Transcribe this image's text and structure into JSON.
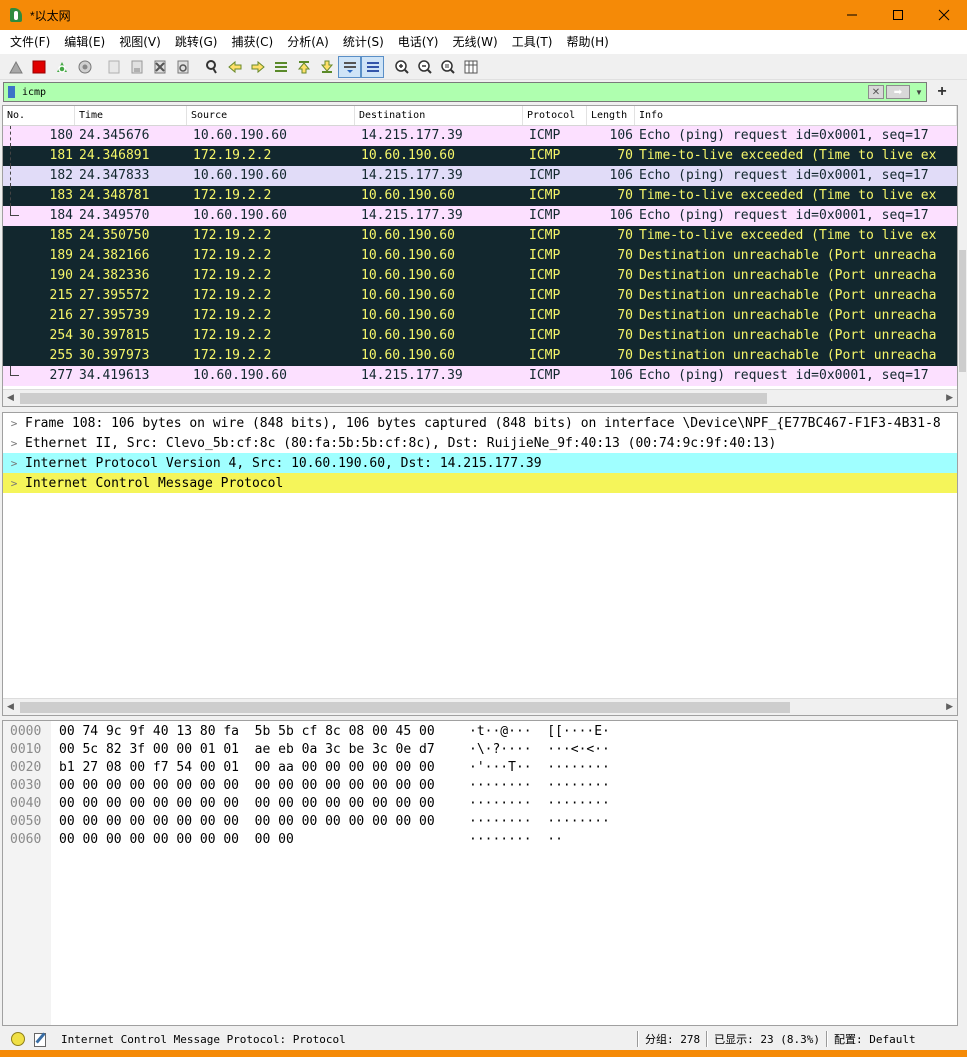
{
  "window": {
    "title": "*以太网",
    "minimize_glyph": "—",
    "maximize_glyph": "☐",
    "close_glyph": "✕"
  },
  "menu": [
    "文件(F)",
    "编辑(E)",
    "视图(V)",
    "跳转(G)",
    "捕获(C)",
    "分析(A)",
    "统计(S)",
    "电话(Y)",
    "无线(W)",
    "工具(T)",
    "帮助(H)"
  ],
  "toolbar": {
    "icons": [
      "shark-fin-start-icon",
      "stop-capture-icon",
      "restart-capture-icon",
      "capture-options-icon",
      "open-file-icon",
      "save-file-icon",
      "close-file-icon",
      "reload-file-icon",
      "find-packet-icon",
      "go-back-icon",
      "go-forward-icon",
      "go-to-packet-icon",
      "first-packet-icon",
      "last-packet-icon",
      "auto-scroll-icon",
      "colorize-icon",
      "zoom-in-icon",
      "zoom-out-icon",
      "zoom-normal-icon",
      "resize-columns-icon"
    ]
  },
  "filter": {
    "value": "icmp",
    "apply_glyph": "➡",
    "clear_glyph": "✕",
    "dropdown_glyph": "▼",
    "add_glyph": "+"
  },
  "packet_list": {
    "columns": [
      "No.",
      "Time",
      "Source",
      "Destination",
      "Protocol",
      "Length",
      "Info"
    ],
    "rows": [
      {
        "no": "180",
        "time": "24.345676",
        "src": "10.60.190.60",
        "dst": "14.215.177.39",
        "proto": "ICMP",
        "len": "106",
        "info": "Echo (ping) request  id=0x0001, seq=17",
        "style": "pink",
        "tree": "line"
      },
      {
        "no": "181",
        "time": "24.346891",
        "src": "172.19.2.2",
        "dst": "10.60.190.60",
        "proto": "ICMP",
        "len": "70",
        "info": "Time-to-live exceeded (Time to live ex",
        "style": "dark",
        "tree": "line"
      },
      {
        "no": "182",
        "time": "24.347833",
        "src": "10.60.190.60",
        "dst": "14.215.177.39",
        "proto": "ICMP",
        "len": "106",
        "info": "Echo (ping) request  id=0x0001, seq=17",
        "style": "lav",
        "tree": "line"
      },
      {
        "no": "183",
        "time": "24.348781",
        "src": "172.19.2.2",
        "dst": "10.60.190.60",
        "proto": "ICMP",
        "len": "70",
        "info": "Time-to-live exceeded (Time to live ex",
        "style": "dark",
        "tree": "line"
      },
      {
        "no": "184",
        "time": "24.349570",
        "src": "10.60.190.60",
        "dst": "14.215.177.39",
        "proto": "ICMP",
        "len": "106",
        "info": "Echo (ping) request  id=0x0001, seq=17",
        "style": "pink",
        "tree": "end"
      },
      {
        "no": "185",
        "time": "24.350750",
        "src": "172.19.2.2",
        "dst": "10.60.190.60",
        "proto": "ICMP",
        "len": "70",
        "info": "Time-to-live exceeded (Time to live ex",
        "style": "dark",
        "tree": ""
      },
      {
        "no": "189",
        "time": "24.382166",
        "src": "172.19.2.2",
        "dst": "10.60.190.60",
        "proto": "ICMP",
        "len": "70",
        "info": "Destination unreachable (Port unreacha",
        "style": "dark",
        "tree": ""
      },
      {
        "no": "190",
        "time": "24.382336",
        "src": "172.19.2.2",
        "dst": "10.60.190.60",
        "proto": "ICMP",
        "len": "70",
        "info": "Destination unreachable (Port unreacha",
        "style": "dark",
        "tree": ""
      },
      {
        "no": "215",
        "time": "27.395572",
        "src": "172.19.2.2",
        "dst": "10.60.190.60",
        "proto": "ICMP",
        "len": "70",
        "info": "Destination unreachable (Port unreacha",
        "style": "dark",
        "tree": ""
      },
      {
        "no": "216",
        "time": "27.395739",
        "src": "172.19.2.2",
        "dst": "10.60.190.60",
        "proto": "ICMP",
        "len": "70",
        "info": "Destination unreachable (Port unreacha",
        "style": "dark",
        "tree": ""
      },
      {
        "no": "254",
        "time": "30.397815",
        "src": "172.19.2.2",
        "dst": "10.60.190.60",
        "proto": "ICMP",
        "len": "70",
        "info": "Destination unreachable (Port unreacha",
        "style": "dark",
        "tree": ""
      },
      {
        "no": "255",
        "time": "30.397973",
        "src": "172.19.2.2",
        "dst": "10.60.190.60",
        "proto": "ICMP",
        "len": "70",
        "info": "Destination unreachable (Port unreacha",
        "style": "dark",
        "tree": ""
      },
      {
        "no": "277",
        "time": "34.419613",
        "src": "10.60.190.60",
        "dst": "14.215.177.39",
        "proto": "ICMP",
        "len": "106",
        "info": "Echo (ping) request  id=0x0001, seq=17",
        "style": "pink",
        "tree": "end"
      }
    ]
  },
  "details": {
    "rows": [
      {
        "text": "Frame 108: 106 bytes on wire (848 bits), 106 bytes captured (848 bits) on interface \\Device\\NPF_{E77BC467-F1F3-4B31-8",
        "style": ""
      },
      {
        "text": "Ethernet II, Src: Clevo_5b:cf:8c (80:fa:5b:5b:cf:8c), Dst: RuijieNe_9f:40:13 (00:74:9c:9f:40:13)",
        "style": ""
      },
      {
        "text": "Internet Protocol Version 4, Src: 10.60.190.60, Dst: 14.215.177.39",
        "style": "cyan"
      },
      {
        "text": "Internet Control Message Protocol",
        "style": "yellow"
      }
    ],
    "expand_glyph": ">"
  },
  "bytes": {
    "offsets": [
      "0000",
      "0010",
      "0020",
      "0030",
      "0040",
      "0050",
      "0060"
    ],
    "hex": [
      "00 74 9c 9f 40 13 80 fa  5b 5b cf 8c 08 00 45 00",
      "00 5c 82 3f 00 00 01 01  ae eb 0a 3c be 3c 0e d7",
      "b1 27 08 00 f7 54 00 01  00 aa 00 00 00 00 00 00",
      "00 00 00 00 00 00 00 00  00 00 00 00 00 00 00 00",
      "00 00 00 00 00 00 00 00  00 00 00 00 00 00 00 00",
      "00 00 00 00 00 00 00 00  00 00 00 00 00 00 00 00",
      "00 00 00 00 00 00 00 00  00 00"
    ],
    "ascii": [
      "·t··@···  [[····E·",
      "·\\·?····  ···<·<··",
      "·'···T··  ········",
      "········  ········",
      "········  ········",
      "········  ········",
      "········  ··"
    ]
  },
  "status": {
    "text": "Internet Control Message Protocol: Protocol",
    "packets": "分组: 278",
    "displayed": "已显示: 23 (8.3%)",
    "profile": "配置: Default"
  },
  "colors": {
    "titlebar": "#f58a07",
    "row_pink": "#fce0ff",
    "row_lavender": "#e1dcf8",
    "row_dark": "#12272e",
    "row_dark_text": "#f7f76a",
    "filter_ok": "#afffaf",
    "detail_cyan": "#a0ffff",
    "detail_yellow": "#f5f55a"
  }
}
